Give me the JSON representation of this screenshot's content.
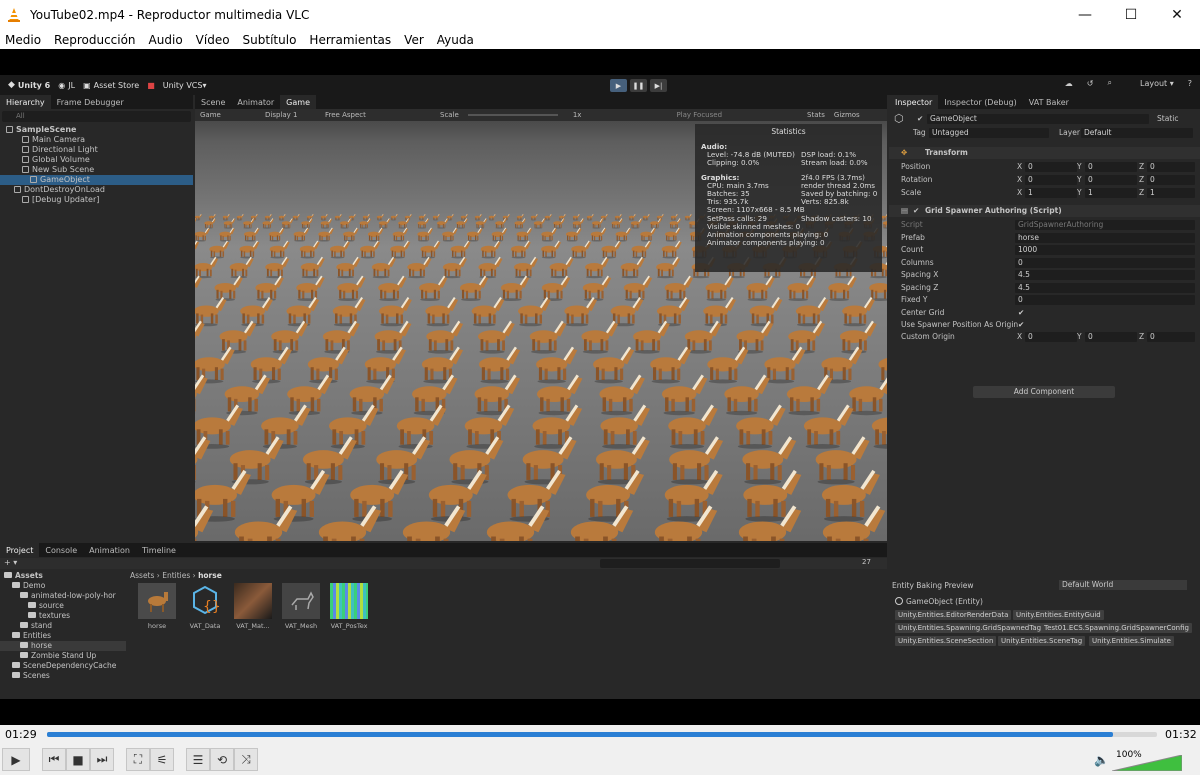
{
  "window": {
    "title": "YouTube02.mp4 - Reproductor multimedia VLC"
  },
  "menu": [
    "Medio",
    "Reproducción",
    "Audio",
    "Vídeo",
    "Subtítulo",
    "Herramientas",
    "Ver",
    "Ayuda"
  ],
  "unity": {
    "toolbar": {
      "brand": "Unity 6",
      "account": "JL",
      "asset_store": "Asset Store",
      "vcs": "Unity VCS",
      "layout": "Layout"
    },
    "hierarchy": {
      "tabs": [
        "Hierarchy",
        "Frame Debugger"
      ],
      "search_placeholder": "All",
      "items": [
        {
          "label": "SampleScene",
          "indent": 0,
          "bold": true
        },
        {
          "label": "Main Camera",
          "indent": 2
        },
        {
          "label": "Directional Light",
          "indent": 2
        },
        {
          "label": "Global Volume",
          "indent": 2
        },
        {
          "label": "New Sub Scene",
          "indent": 2
        },
        {
          "label": "GameObject",
          "indent": 3,
          "selected": true
        },
        {
          "label": "DontDestroyOnLoad",
          "indent": 1
        },
        {
          "label": "[Debug Updater]",
          "indent": 2
        }
      ]
    },
    "game": {
      "tabs": [
        "Scene",
        "Animator",
        "Game"
      ],
      "bar": {
        "mode": "Game",
        "display": "Display 1",
        "aspect": "Free Aspect",
        "scale_label": "Scale",
        "scale_value": "1x",
        "play_focused": "Play Focused",
        "stats": "Stats",
        "gizmos": "Gizmos"
      },
      "statistics": {
        "title": "Statistics",
        "audio_header": "Audio:",
        "audio_lines": [
          [
            "Level: -74.8 dB (MUTED)",
            "DSP load: 0.1%"
          ],
          [
            "Clipping: 0.0%",
            "Stream load: 0.0%"
          ]
        ],
        "graphics_header": "Graphics:",
        "fps": "2f4.0 FPS (3.7ms)",
        "graphics_lines": [
          [
            "CPU: main 3.7ms",
            "render thread 2.0ms"
          ],
          [
            "Batches: 35",
            "Saved by batching: 0"
          ],
          [
            "Tris: 935.7k",
            "Verts: 825.8k"
          ],
          [
            "Screen: 1107x668 - 8.5 MB",
            ""
          ],
          [
            "SetPass calls: 29",
            "Shadow casters: 10"
          ],
          [
            "Visible skinned meshes: 0",
            ""
          ],
          [
            "Animation components playing: 0",
            ""
          ],
          [
            "Animator components playing: 0",
            ""
          ]
        ]
      }
    },
    "inspector": {
      "tabs": [
        "Inspector",
        "Inspector (Debug)",
        "VAT Baker"
      ],
      "object_name": "GameObject",
      "static_label": "Static",
      "tag_label": "Tag",
      "tag_value": "Untagged",
      "layer_label": "Layer",
      "layer_value": "Default",
      "transform": {
        "title": "Transform",
        "rows": [
          {
            "label": "Position",
            "x": "0",
            "y": "0",
            "z": "0"
          },
          {
            "label": "Rotation",
            "x": "0",
            "y": "0",
            "z": "0"
          },
          {
            "label": "Scale",
            "x": "1",
            "y": "1",
            "z": "1"
          }
        ]
      },
      "spawner": {
        "title": "Grid Spawner Authoring (Script)",
        "fields": [
          {
            "label": "Script",
            "value": "GridSpawnerAuthoring"
          },
          {
            "label": "Prefab",
            "value": "horse"
          },
          {
            "label": "Count",
            "value": "1000"
          },
          {
            "label": "Columns",
            "value": "0"
          },
          {
            "label": "Spacing X",
            "value": "4.5"
          },
          {
            "label": "Spacing Z",
            "value": "4.5"
          },
          {
            "label": "Fixed Y",
            "value": "0"
          },
          {
            "label": "Center Grid",
            "value": "✔"
          },
          {
            "label": "Use Spawner Position As Origin",
            "value": "✔"
          }
        ],
        "origin": {
          "label": "Custom Origin",
          "x": "0",
          "y": "0",
          "z": "0"
        }
      },
      "add_component": "Add Component"
    },
    "project": {
      "tabs": [
        "Project",
        "Console",
        "Animation",
        "Timeline"
      ],
      "breadcrumb": [
        "Assets",
        "Entities",
        "horse"
      ],
      "slider_count": "27",
      "tree": [
        {
          "label": "Assets",
          "indent": 0,
          "bold": true
        },
        {
          "label": "Demo",
          "indent": 1
        },
        {
          "label": "animated-low-poly-hor",
          "indent": 2
        },
        {
          "label": "source",
          "indent": 3
        },
        {
          "label": "textures",
          "indent": 3
        },
        {
          "label": "stand",
          "indent": 2
        },
        {
          "label": "Entities",
          "indent": 1
        },
        {
          "label": "horse",
          "indent": 2,
          "selected": true
        },
        {
          "label": "Zombie Stand Up",
          "indent": 2
        },
        {
          "label": "SceneDependencyCache",
          "indent": 1
        },
        {
          "label": "Scenes",
          "indent": 1
        }
      ],
      "assets": [
        "horse",
        "VAT_Data",
        "VAT_Mat...",
        "VAT_Mesh",
        "VAT_PosTex"
      ]
    },
    "baking": {
      "title": "Entity Baking Preview",
      "world": "Default World",
      "entity": "GameObject (Entity)",
      "components": [
        "Unity.Entities.EditorRenderData",
        "Unity.Entities.EntityGuid",
        "Unity.Entities.Spawning.GridSpawnedTag",
        "Test01.ECS.Spawning.GridSpawnerConfig",
        "Unity.Entities.SceneSection",
        "Unity.Entities.SceneTag",
        "Unity.Entities.Simulate"
      ]
    }
  },
  "player": {
    "elapsed": "01:29",
    "remaining": "01:32",
    "progress": 0.96,
    "volume": "100%",
    "accent": "#2b7fd4"
  }
}
